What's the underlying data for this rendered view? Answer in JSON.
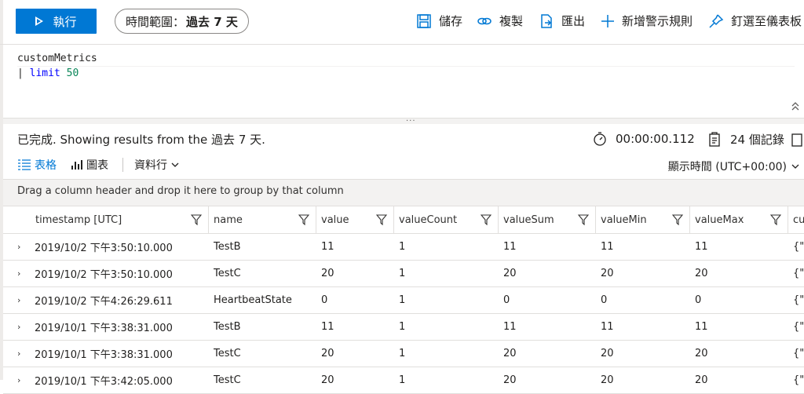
{
  "toolbar": {
    "run_label": "執行",
    "time_range_prefix": "時間範圍：",
    "time_range_value": "過去 7 天",
    "save_label": "儲存",
    "copy_label": "複製",
    "export_label": "匯出",
    "new_alert_label": "新增警示規則",
    "pin_label": "釘選至儀表板"
  },
  "editor": {
    "line1": "customMetrics",
    "line2_pipe": "| ",
    "line2_keyword": "limit",
    "line2_number": "50",
    "splitter_dots": "..."
  },
  "results": {
    "status": "已完成. Showing results from the 過去 7 天.",
    "elapsed": "00:00:00.112",
    "record_count": "24 個記錄"
  },
  "view_tabs": {
    "table": "表格",
    "chart": "圖表",
    "columns": "資料行"
  },
  "display_time": "顯示時間 (UTC+00:00)",
  "group_hint": "Drag a column header and drop it here to group by that column",
  "table": {
    "headers": [
      "timestamp [UTC]",
      "name",
      "value",
      "valueCount",
      "valueSum",
      "valueMin",
      "valueMax",
      "cu"
    ],
    "rows": [
      [
        "2019/10/2 下午3:50:10.000",
        "TestB",
        "11",
        "1",
        "11",
        "11",
        "11",
        "{\"_"
      ],
      [
        "2019/10/2 下午3:50:10.000",
        "TestC",
        "20",
        "1",
        "20",
        "20",
        "20",
        "{\"_"
      ],
      [
        "2019/10/2 下午4:26:29.611",
        "HeartbeatState",
        "0",
        "1",
        "0",
        "0",
        "0",
        "{\"I"
      ],
      [
        "2019/10/1 下午3:38:31.000",
        "TestB",
        "11",
        "1",
        "11",
        "11",
        "11",
        "{\"_"
      ],
      [
        "2019/10/1 下午3:38:31.000",
        "TestC",
        "20",
        "1",
        "20",
        "20",
        "20",
        "{\"_"
      ],
      [
        "2019/10/1 下午3:42:05.000",
        "TestC",
        "20",
        "1",
        "20",
        "20",
        "20",
        "{\"_"
      ]
    ]
  },
  "colors": {
    "accent": "#0078d4",
    "border": "#e1dfdd",
    "group_bar": "#f3f2f1"
  }
}
